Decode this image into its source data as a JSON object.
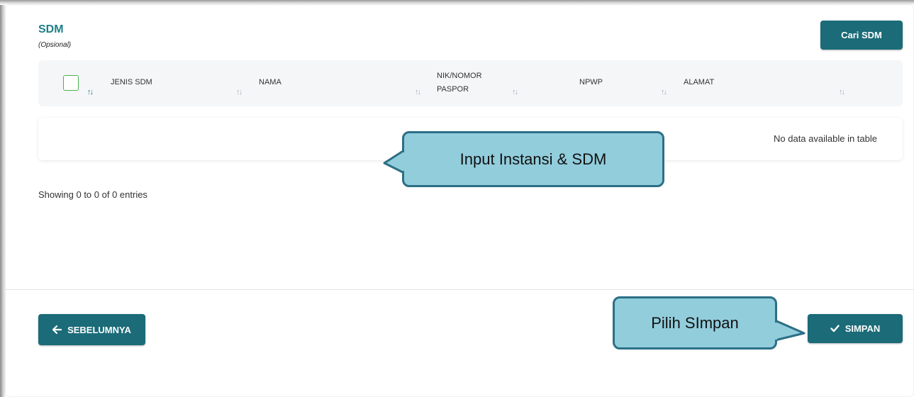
{
  "section": {
    "title": "SDM",
    "subtitle": "(Opsional)"
  },
  "buttons": {
    "cari_sdm": "Cari SDM",
    "sebelumnya": "SEBELUMNYA",
    "simpan": "SIMPAN"
  },
  "table": {
    "columns": [
      "JENIS SDM",
      "NAMA",
      "NIK/NOMOR",
      "PASPOR",
      "NPWP",
      "ALAMAT"
    ],
    "empty_message": "No data available in table",
    "info": "Showing 0 to 0 of 0 entries"
  },
  "callouts": {
    "input": "Input Instansi & SDM",
    "save": "Pilih SImpan"
  },
  "colors": {
    "accent": "#1b6b78",
    "title": "#1e7f87",
    "callout_fill": "#92cddc",
    "callout_border": "#2c6f86"
  },
  "icons": {
    "sort": "sort-icon",
    "arrow_left": "arrow-left-icon",
    "check": "check-icon"
  }
}
